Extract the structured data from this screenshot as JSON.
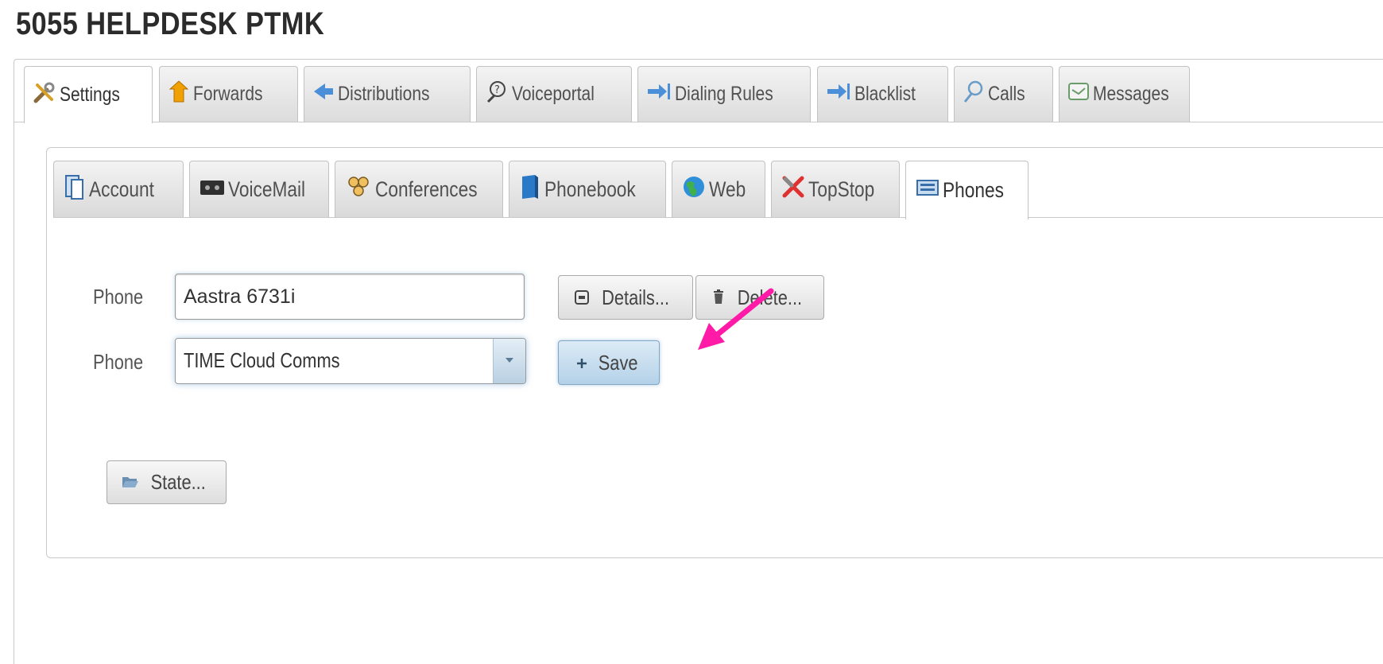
{
  "page": {
    "title": "5055 HELPDESK PTMK"
  },
  "main_tabs": [
    {
      "label": "Settings",
      "icon": "wrench-icon",
      "active": true
    },
    {
      "label": "Forwards",
      "icon": "forward-arrow-icon",
      "active": false
    },
    {
      "label": "Distributions",
      "icon": "distribution-arrow-icon",
      "active": false
    },
    {
      "label": "Voiceportal",
      "icon": "voiceportal-icon",
      "active": false
    },
    {
      "label": "Dialing Rules",
      "icon": "dialing-rules-icon",
      "active": false
    },
    {
      "label": "Blacklist",
      "icon": "blacklist-icon",
      "active": false
    },
    {
      "label": "Calls",
      "icon": "calls-icon",
      "active": false
    },
    {
      "label": "Messages",
      "icon": "messages-icon",
      "active": false
    }
  ],
  "sub_tabs": [
    {
      "label": "Account",
      "icon": "account-icon",
      "active": false
    },
    {
      "label": "VoiceMail",
      "icon": "voicemail-icon",
      "active": false
    },
    {
      "label": "Conferences",
      "icon": "conferences-icon",
      "active": false
    },
    {
      "label": "Phonebook",
      "icon": "phonebook-icon",
      "active": false
    },
    {
      "label": "Web",
      "icon": "globe-icon",
      "active": false
    },
    {
      "label": "TopStop",
      "icon": "topstop-icon",
      "active": false
    },
    {
      "label": "Phones",
      "icon": "phones-icon",
      "active": true
    }
  ],
  "form": {
    "phone_label_1": "Phone",
    "phone_value": "Aastra 6731i",
    "phone_label_2": "Phone",
    "provider_selected": "TIME Cloud Comms",
    "details_label": "Details...",
    "delete_label": "Delete...",
    "save_label": "Save",
    "state_label": "State..."
  },
  "colors": {
    "annotation_arrow": "#ff1aa8",
    "save_button": "#c7dff1"
  }
}
